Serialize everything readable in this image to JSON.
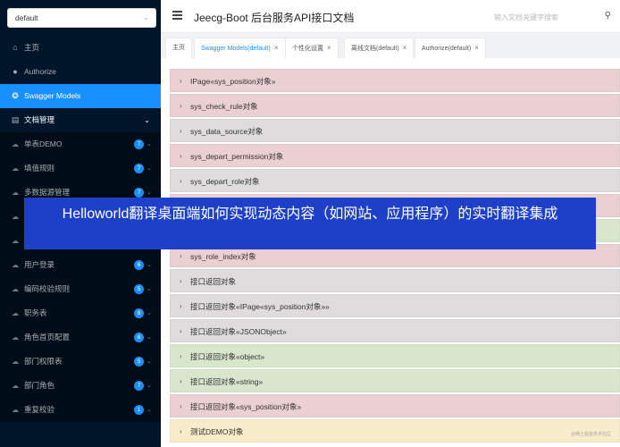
{
  "sidebar": {
    "select_value": "default",
    "items": [
      {
        "label": "主页",
        "icon": "home-icon",
        "glyph": "⌂"
      },
      {
        "label": "Authorize",
        "icon": "authorize-icon",
        "glyph": "●"
      },
      {
        "label": "Swagger Models",
        "icon": "swagger-models-icon",
        "glyph": "❂"
      }
    ],
    "group": {
      "label": "文档管理",
      "icon": "document-icon",
      "glyph": "▤",
      "caret": "⌄"
    },
    "sub_items": [
      {
        "label": "单表DEMO",
        "badge": "7"
      },
      {
        "label": "填值规则",
        "badge": "7"
      },
      {
        "label": "多数据源管理",
        "badge": "7"
      },
      {
        "label": "",
        "badge": ""
      },
      {
        "label": "",
        "badge": ""
      },
      {
        "label": "用户登录",
        "badge": "6"
      },
      {
        "label": "编码校验规则",
        "badge": "5"
      },
      {
        "label": "职务表",
        "badge": "8"
      },
      {
        "label": "角色首页配置",
        "badge": "8"
      },
      {
        "label": "部门权限表",
        "badge": "5"
      },
      {
        "label": "部门角色",
        "badge": "7"
      },
      {
        "label": "重复校验",
        "badge": "1"
      }
    ]
  },
  "header": {
    "title": "Jeecg-Boot 后台服务API接口文档",
    "search_placeholder": "输入文档关键字搜索"
  },
  "tabs": [
    {
      "label": "主页",
      "closable": false
    },
    {
      "label": "Swagger Models(default)",
      "closable": true
    },
    {
      "label": "个性化设置",
      "closable": true
    },
    {
      "label": "离线文档(default)",
      "closable": true
    },
    {
      "label": "Authorize(default)",
      "closable": true
    }
  ],
  "models": [
    {
      "label": "IPage«sys_position对象»",
      "color": "pink"
    },
    {
      "label": "sys_check_rule对象",
      "color": "pink"
    },
    {
      "label": "sys_data_source对象",
      "color": "grey"
    },
    {
      "label": "sys_depart_permission对象",
      "color": "pink"
    },
    {
      "label": "sys_depart_role对象",
      "color": "grey"
    },
    {
      "label": "",
      "color": "pink"
    },
    {
      "label": "",
      "color": "green"
    },
    {
      "label": "sys_role_index对象",
      "color": "pink"
    },
    {
      "label": "接口返回对象",
      "color": "grey"
    },
    {
      "label": "接口返回对象«IPage«sys_position对象»»",
      "color": "grey"
    },
    {
      "label": "接口返回对象«JSONObject»",
      "color": "grey"
    },
    {
      "label": "接口返回对象«object»",
      "color": "green"
    },
    {
      "label": "接口返回对象«string»",
      "color": "green"
    },
    {
      "label": "接口返回对象«sys_position对象»",
      "color": "pink"
    },
    {
      "label": "测试DEMO对象",
      "color": "cream"
    }
  ],
  "banner": "Helloworld翻译桌面端如何实现动态内容（如网站、应用程序）的实时翻译集成",
  "watermark": "@稀土掘金技术社区"
}
